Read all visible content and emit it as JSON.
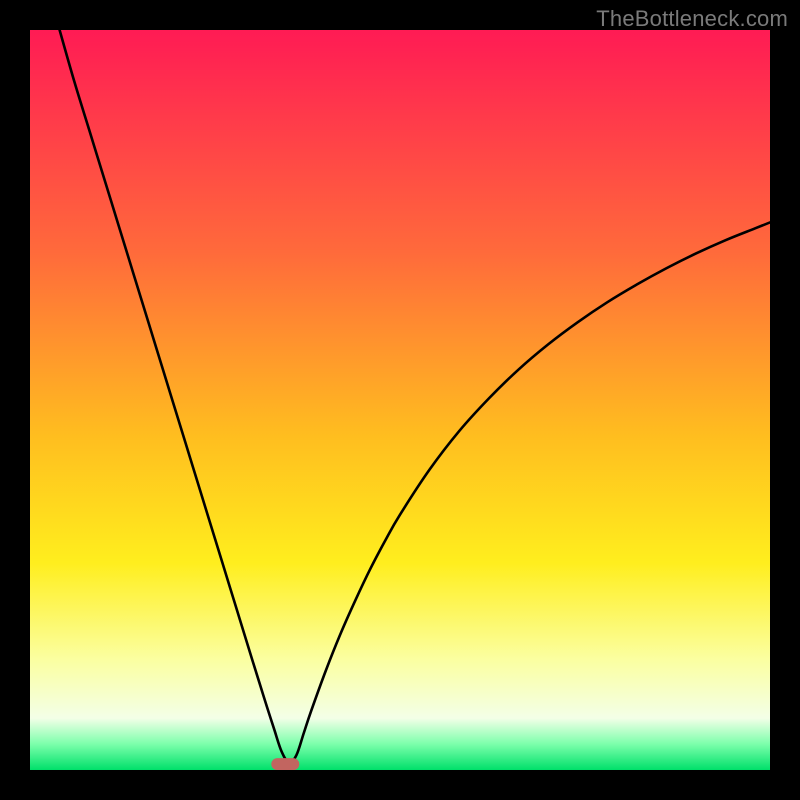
{
  "watermark": "TheBottleneck.com",
  "chart_data": {
    "type": "line",
    "title": "",
    "xlabel": "",
    "ylabel": "",
    "xlim": [
      0,
      100
    ],
    "ylim": [
      0,
      100
    ],
    "grid": false,
    "legend": false,
    "annotations": [
      {
        "type": "marker",
        "shape": "rounded-rect",
        "x": 34.5,
        "y": 0.8,
        "color": "#c26560"
      }
    ],
    "series": [
      {
        "name": "curve",
        "color": "#000000",
        "x": [
          4,
          6,
          8,
          10,
          12,
          14,
          16,
          18,
          20,
          22,
          24,
          26,
          28,
          30,
          31,
          32,
          33,
          34,
          35,
          36,
          37,
          38,
          40,
          42,
          44,
          46,
          48,
          50,
          54,
          58,
          62,
          66,
          70,
          74,
          78,
          82,
          86,
          90,
          94,
          98,
          100
        ],
        "y": [
          100,
          93,
          86.5,
          80,
          73.5,
          67,
          60.5,
          54,
          47.5,
          41,
          34.5,
          28,
          21.5,
          15,
          11.8,
          8.6,
          5.5,
          2.5,
          1.0,
          2.0,
          5.0,
          8.0,
          13.5,
          18.5,
          23.0,
          27.2,
          31.0,
          34.5,
          40.6,
          45.8,
          50.2,
          54.1,
          57.5,
          60.5,
          63.2,
          65.6,
          67.8,
          69.8,
          71.6,
          73.2,
          74.0
        ]
      }
    ],
    "background_gradient": {
      "stops": [
        {
          "pos": 0.0,
          "color": "#ff1b54"
        },
        {
          "pos": 0.3,
          "color": "#ff6a3b"
        },
        {
          "pos": 0.55,
          "color": "#ffbe1f"
        },
        {
          "pos": 0.72,
          "color": "#ffee1e"
        },
        {
          "pos": 0.85,
          "color": "#fbffa0"
        },
        {
          "pos": 0.93,
          "color": "#f3ffe7"
        },
        {
          "pos": 0.965,
          "color": "#7cffab"
        },
        {
          "pos": 1.0,
          "color": "#00e06a"
        }
      ]
    }
  }
}
